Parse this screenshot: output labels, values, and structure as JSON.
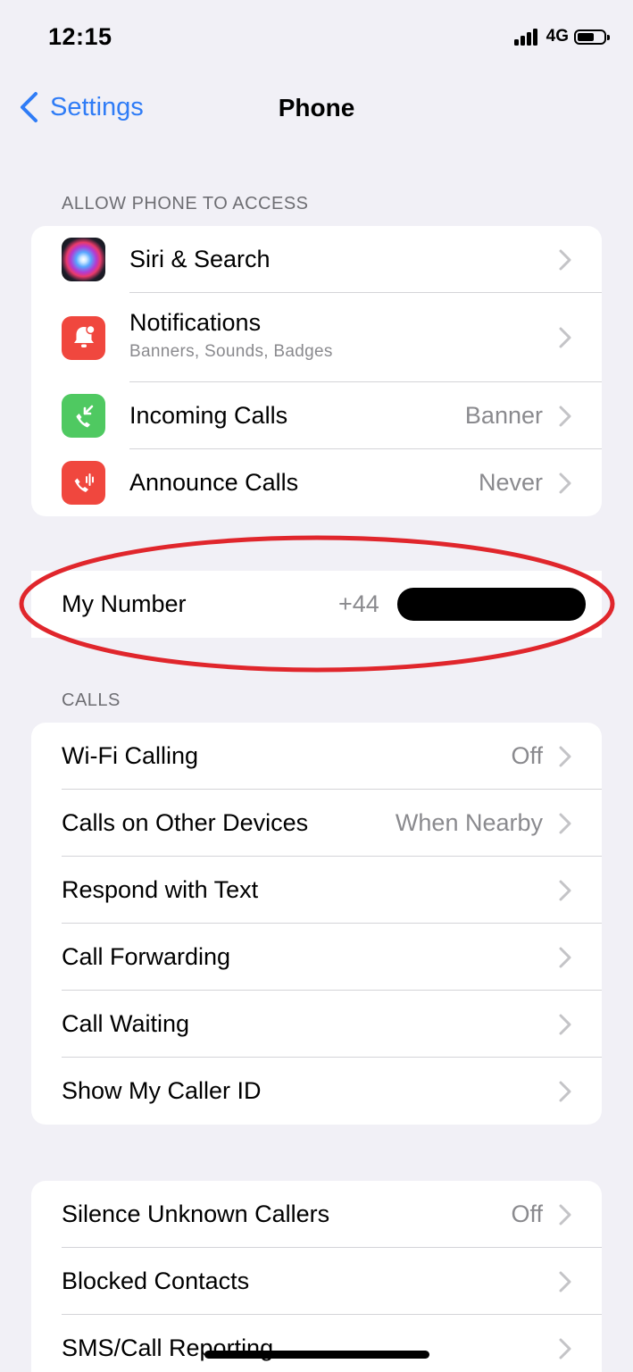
{
  "status_bar": {
    "time": "12:15",
    "network": "4G"
  },
  "nav": {
    "back_label": "Settings",
    "title": "Phone"
  },
  "allow_section": {
    "header": "ALLOW PHONE TO ACCESS",
    "rows": [
      {
        "label": "Siri & Search",
        "icon": "siri-icon"
      },
      {
        "label": "Notifications",
        "subtitle": "Banners, Sounds, Badges",
        "icon": "bell-icon"
      },
      {
        "label": "Incoming Calls",
        "value": "Banner",
        "icon": "incoming-call-icon"
      },
      {
        "label": "Announce Calls",
        "value": "Never",
        "icon": "announce-call-icon"
      }
    ]
  },
  "my_number": {
    "label": "My Number",
    "value": "+44"
  },
  "calls_section": {
    "header": "CALLS",
    "rows": [
      {
        "label": "Wi-Fi Calling",
        "value": "Off"
      },
      {
        "label": "Calls on Other Devices",
        "value": "When Nearby"
      },
      {
        "label": "Respond with Text"
      },
      {
        "label": "Call Forwarding"
      },
      {
        "label": "Call Waiting"
      },
      {
        "label": "Show My Caller ID"
      }
    ]
  },
  "block_section": {
    "rows": [
      {
        "label": "Silence Unknown Callers",
        "value": "Off"
      },
      {
        "label": "Blocked Contacts"
      },
      {
        "label": "SMS/Call Reporting"
      }
    ]
  },
  "colors": {
    "accent": "#2f7cf6",
    "background": "#f1f0f6",
    "highlight": "#e0262c"
  }
}
